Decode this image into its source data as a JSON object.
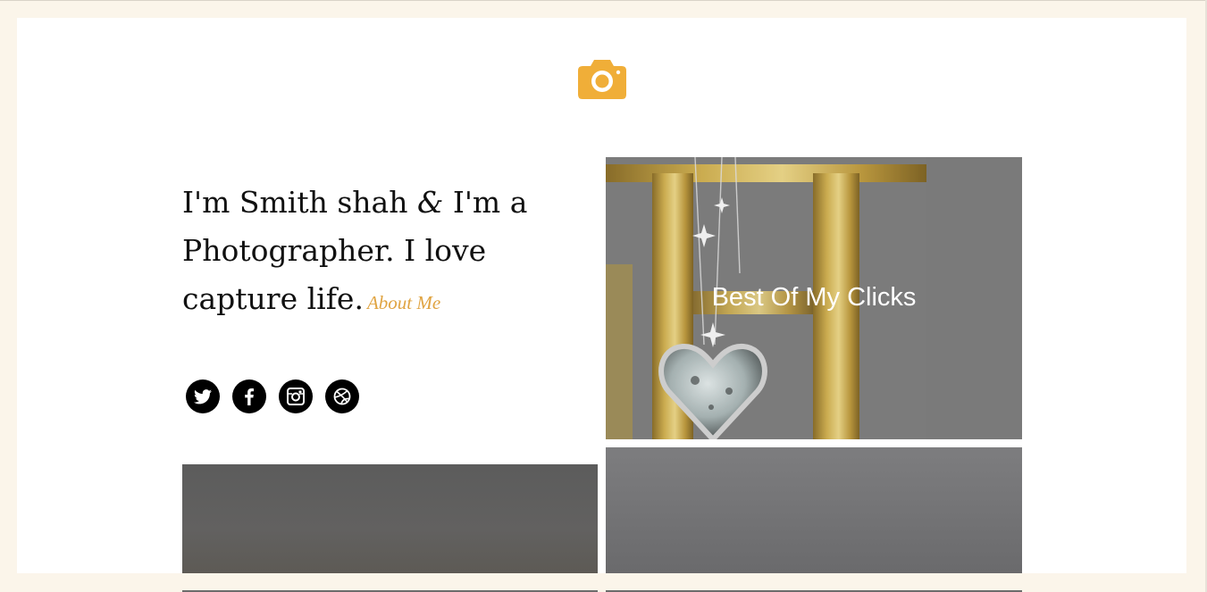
{
  "header": {
    "logo_icon": "camera-icon",
    "accent_color": "#f0ae38"
  },
  "intro": {
    "text_part1": "I'm Smith shah ",
    "ampersand": "&",
    "text_part2": " I'm a Photographer. I love capture life.",
    "about_link": "About Me",
    "about_color": "#e0a442"
  },
  "social": [
    {
      "name": "twitter",
      "icon": "twitter-icon"
    },
    {
      "name": "facebook",
      "icon": "facebook-icon"
    },
    {
      "name": "instagram",
      "icon": "instagram-icon"
    },
    {
      "name": "dribbble",
      "icon": "dribbble-icon"
    }
  ],
  "gallery": {
    "featured_title": "Best Of My Clicks"
  }
}
